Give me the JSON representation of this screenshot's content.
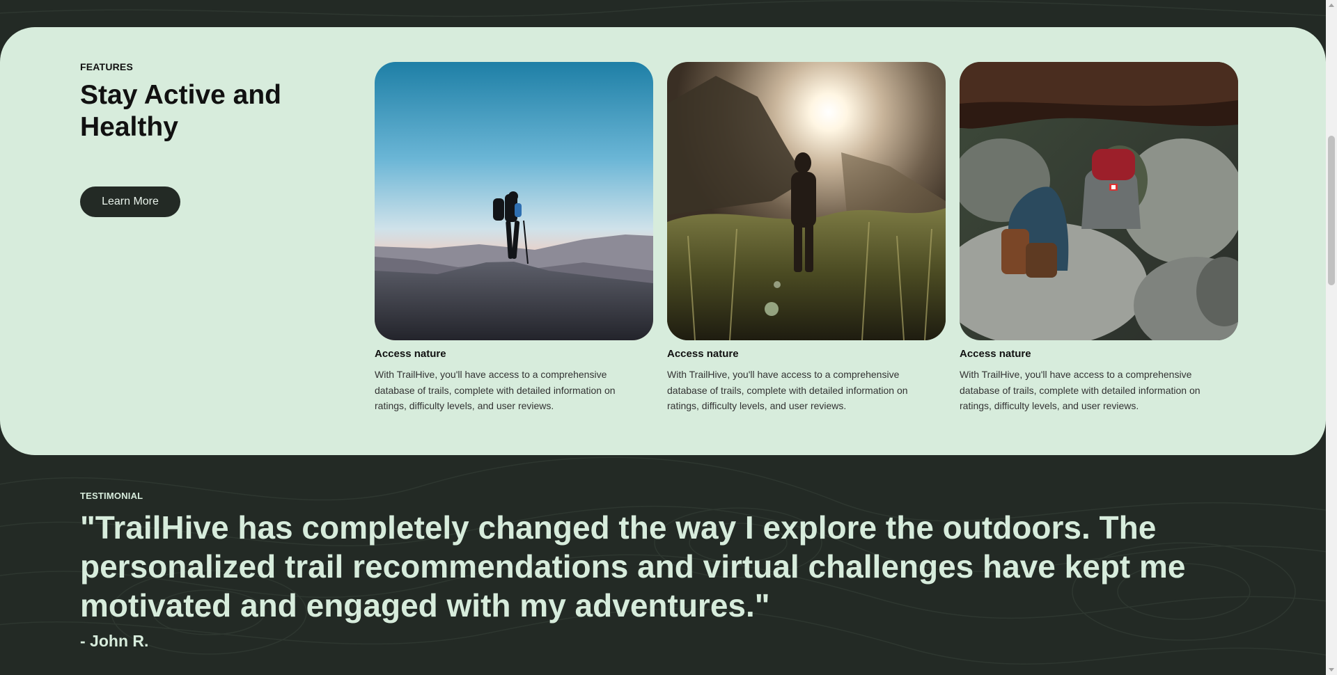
{
  "features": {
    "eyebrow": "FEATURES",
    "title": "Stay Active and Healthy",
    "button_label": "Learn More",
    "cards": [
      {
        "image": "hiker-on-mountain-summit-photo",
        "title": "Access nature",
        "description": "With TrailHive, you'll have access to a comprehensive database of trails, complete with detailed information on ratings, difficulty levels, and user reviews."
      },
      {
        "image": "hiker-in-sunlit-forest-photo",
        "title": "Access nature",
        "description": "With TrailHive, you'll have access to a comprehensive database of trails, complete with detailed information on ratings, difficulty levels, and user reviews."
      },
      {
        "image": "backpacks-and-boots-on-rocks-photo",
        "title": "Access nature",
        "description": "With TrailHive, you'll have access to a comprehensive database of trails, complete with detailed information on ratings, difficulty levels, and user reviews."
      }
    ]
  },
  "testimonial": {
    "eyebrow": "TESTIMONIAL",
    "quote": "\"TrailHive has completely changed the way I explore the outdoors. The personalized trail recommendations and virtual challenges have kept me motivated and engaged with my adventures.\"",
    "author": "- John R."
  },
  "colors": {
    "background_dark": "#232a25",
    "card_mint": "#d7ecdc",
    "text_light": "#d7ecdc"
  }
}
